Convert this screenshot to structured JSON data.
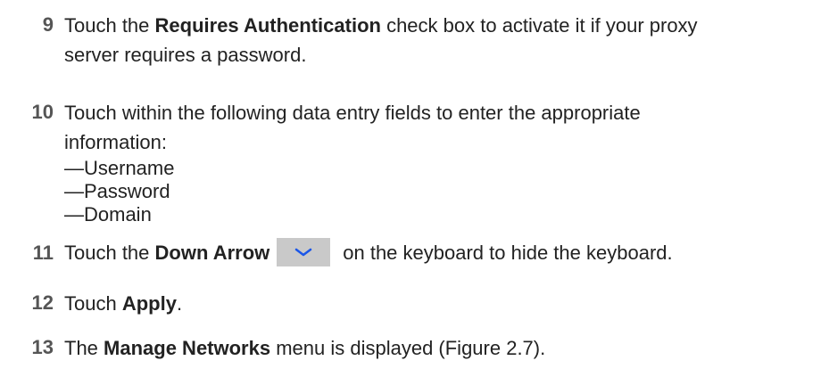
{
  "steps": [
    {
      "number": "9",
      "lines": [
        {
          "before": "Touch the ",
          "bold": "Requires Authentication",
          "after": " check box to activate it if your proxy"
        },
        {
          "text": "server requires a password."
        }
      ]
    },
    {
      "number": "10",
      "lines": [
        {
          "text": "Touch within the following data entry fields to enter the appropriate"
        },
        {
          "text": "information:"
        }
      ],
      "subitems": [
        "—Username",
        "—Password",
        "—Domain"
      ]
    },
    {
      "number": "11",
      "before": "Touch the ",
      "bold": "Down Arrow",
      "icon": "chevron-down-icon",
      "after": "on the keyboard to hide the keyboard."
    },
    {
      "number": "12",
      "before": "Touch ",
      "bold": "Apply",
      "after": "."
    },
    {
      "number": "13",
      "before": "The ",
      "bold": "Manage Networks",
      "after": " menu is displayed (Figure 2.7)."
    }
  ],
  "colors": {
    "step_number": "#555555",
    "text": "#222222",
    "key_background": "#c9c9c9",
    "chevron": "#1a56e8"
  }
}
